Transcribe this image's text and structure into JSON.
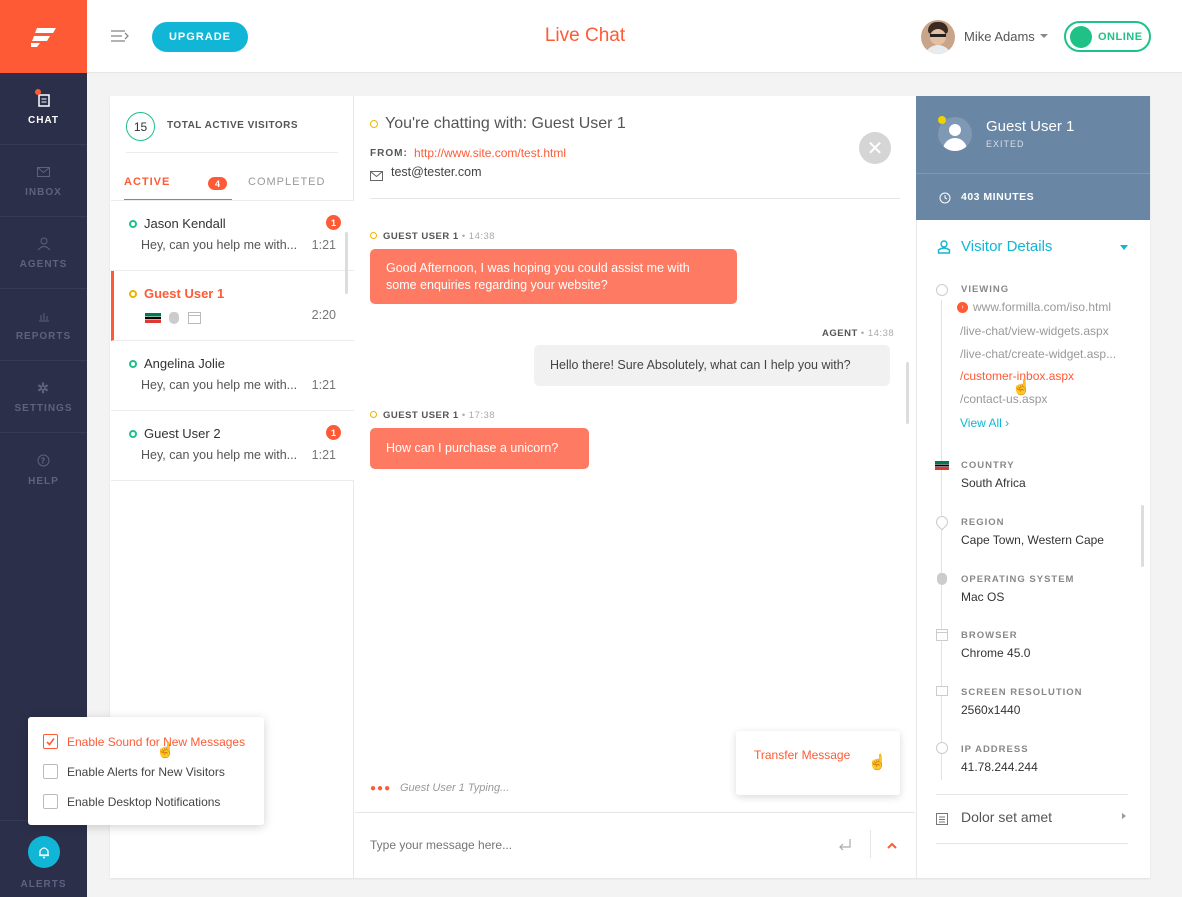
{
  "header": {
    "upgrade_label": "UPGRADE",
    "title": "Live Chat",
    "user_name": "Mike Adams",
    "status_label": "ONLINE"
  },
  "sidebar": {
    "items": [
      {
        "label": "CHAT",
        "icon": "chat-icon",
        "active": true
      },
      {
        "label": "INBOX",
        "icon": "inbox-icon"
      },
      {
        "label": "AGENTS",
        "icon": "agents-icon"
      },
      {
        "label": "REPORTS",
        "icon": "reports-icon"
      },
      {
        "label": "SETTINGS",
        "icon": "gear-icon"
      },
      {
        "label": "HELP",
        "icon": "help-icon"
      }
    ],
    "alerts_label": "ALERTS"
  },
  "visitors": {
    "total_count": "15",
    "total_label": "TOTAL ACTIVE VISITORS",
    "tab_active": "ACTIVE",
    "active_badge": "4",
    "tab_completed": "COMPLETED",
    "list": [
      {
        "name": "Jason Kendall",
        "message": "Hey, can you help me with...",
        "time": "1:21",
        "badge": "1"
      },
      {
        "name": "Guest User 1",
        "message": "",
        "time": "2:20",
        "badge": ""
      },
      {
        "name": "Angelina Jolie",
        "message": "Hey, can you help me with...",
        "time": "1:21",
        "badge": ""
      },
      {
        "name": "Guest User 2",
        "message": "Hey, can you help me with...",
        "time": "1:21",
        "badge": "1"
      }
    ]
  },
  "chat": {
    "heading": "You're chatting with: Guest User 1",
    "from_label": "FROM:",
    "from_url": "http://www.site.com/test.html",
    "email": "test@tester.com",
    "messages": [
      {
        "sender": "GUEST USER 1",
        "time": "14:38",
        "text": "Good Afternoon, I was hoping you could assist me with some enquiries regarding your website?"
      },
      {
        "sender": "AGENT",
        "time": "14:38",
        "text": "Hello there! Sure Absolutely, what can I help you with?"
      },
      {
        "sender": "GUEST USER 1",
        "time": "17:38",
        "text": "How can I purchase a unicorn?"
      }
    ],
    "typing": "Guest User 1 Typing...",
    "input_placeholder": "Type your message here...",
    "transfer_label": "Transfer Message"
  },
  "details": {
    "name": "Guest User 1",
    "status": "EXITED",
    "duration": "403 MINUTES",
    "section_title": "Visitor Details",
    "viewing_label": "VIEWING",
    "pages": [
      "www.formilla.com/iso.html",
      "/live-chat/view-widgets.aspx",
      "/live-chat/create-widget.asp...",
      "/customer-inbox.aspx",
      "/contact-us.aspx"
    ],
    "view_all": "View All",
    "country_label": "COUNTRY",
    "country": "South Africa",
    "region_label": "REGION",
    "region": "Cape Town, Western Cape",
    "os_label": "OPERATING SYSTEM",
    "os": "Mac OS",
    "browser_label": "BROWSER",
    "browser": "Chrome 45.0",
    "resolution_label": "SCREEN RESOLUTION",
    "resolution": "2560x1440",
    "ip_label": "IP ADDRESS",
    "ip": "41.78.244.244",
    "extra_section": "Dolor set amet"
  },
  "popup": {
    "options": [
      {
        "label": "Enable Sound for New Messages",
        "checked": true
      },
      {
        "label": "Enable Alerts for New Visitors",
        "checked": false
      },
      {
        "label": "Enable Desktop Notifications",
        "checked": false
      }
    ]
  },
  "colors": {
    "accent": "#ff5a36",
    "sidebar": "#2b2f4a",
    "teal": "#11b6d6",
    "online": "#20c187",
    "panel": "#6a86a5"
  }
}
